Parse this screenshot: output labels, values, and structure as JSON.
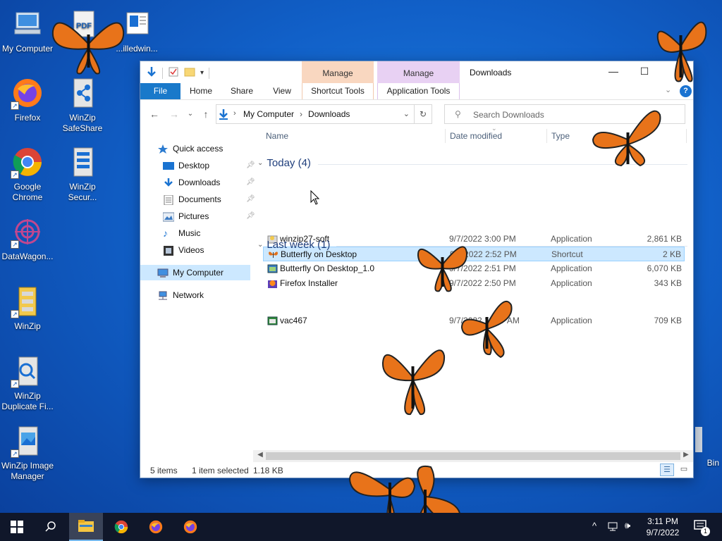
{
  "desktop": {
    "icons": [
      {
        "label": "My Computer",
        "icon": "computer-icon"
      },
      {
        "label": "...",
        "icon": "pdf-icon"
      },
      {
        "label": "...illedwin...",
        "icon": "window-icon"
      },
      {
        "label": "Firefox",
        "icon": "firefox-icon"
      },
      {
        "label": "WinZip SafeShare",
        "icon": "winzip-safeshare-icon"
      },
      {
        "label": "Google Chrome",
        "icon": "chrome-icon"
      },
      {
        "label": "WinZip Secur...",
        "icon": "winzip-secure-icon"
      },
      {
        "label": "DataWagon...",
        "icon": "datawagon-icon"
      },
      {
        "label": "WinZip",
        "icon": "winzip-icon"
      },
      {
        "label": "WinZip Duplicate Fi...",
        "icon": "winzip-duplicate-icon"
      },
      {
        "label": "WinZip Image Manager",
        "icon": "winzip-image-icon"
      },
      {
        "label": "Bin",
        "icon": "recycle-bin-icon"
      }
    ]
  },
  "window": {
    "title": "Downloads",
    "context_tabs": {
      "manage1": "Manage",
      "manage2": "Manage"
    },
    "ribbon_tabs": {
      "file": "File",
      "home": "Home",
      "share": "Share",
      "view": "View",
      "shortcut_tools": "Shortcut Tools",
      "application_tools": "Application Tools"
    },
    "address": {
      "crumb1": "My Computer",
      "crumb2": "Downloads"
    },
    "search_placeholder": "Search Downloads",
    "nav": {
      "quick_access": "Quick access",
      "desktop": "Desktop",
      "downloads": "Downloads",
      "documents": "Documents",
      "pictures": "Pictures",
      "music": "Music",
      "videos": "Videos",
      "my_computer": "My Computer",
      "network": "Network"
    },
    "columns": {
      "name": "Name",
      "date": "Date modified",
      "type": "Type"
    },
    "groups": {
      "today": "Today (4)",
      "last_week": "Last week (1)"
    },
    "files": [
      {
        "name": "winzip27-soft",
        "date": "9/7/2022 3:00 PM",
        "type": "Application",
        "size": "2,861 KB"
      },
      {
        "name": "Butterfly on Desktop",
        "date": "9/7/2022 2:52 PM",
        "type": "Shortcut",
        "size": "2 KB"
      },
      {
        "name": "Butterfly On Desktop_1.0",
        "date": "9/7/2022 2:51 PM",
        "type": "Application",
        "size": "6,070 KB"
      },
      {
        "name": "Firefox Installer",
        "date": "9/7/2022 2:50 PM",
        "type": "Application",
        "size": "343 KB"
      },
      {
        "name": "vac467",
        "date": "9/7/2022 11:37 AM",
        "type": "Application",
        "size": "709 KB"
      }
    ],
    "status": {
      "items": "5 items",
      "selected": "1 item selected",
      "size": "1.18 KB"
    }
  },
  "taskbar": {
    "time": "3:11 PM",
    "date": "9/7/2022",
    "notification_count": "1"
  },
  "colors": {
    "file_tab": "#1979ca",
    "selection": "#cce8ff",
    "manage1_bg": "#f9d7c0",
    "manage2_bg": "#e8d1f3",
    "taskbar": "#10172a"
  }
}
